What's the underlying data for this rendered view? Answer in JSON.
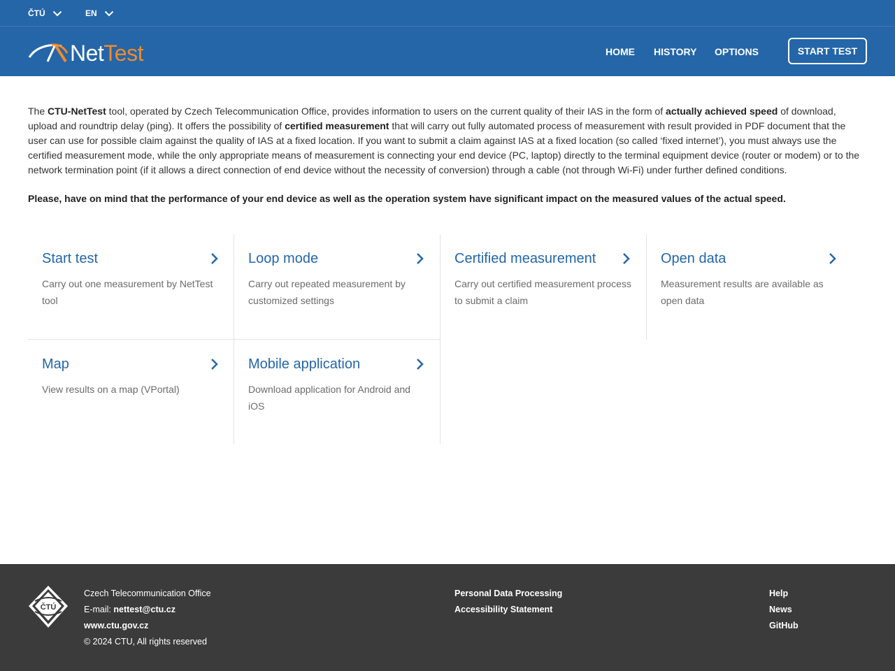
{
  "topbar": {
    "org_selector": "ČTÚ",
    "lang_selector": "EN"
  },
  "header": {
    "logo_net": "Net",
    "logo_test": "Test",
    "nav": {
      "home": "HOME",
      "history": "HISTORY",
      "options": "OPTIONS"
    },
    "start_button": "START TEST"
  },
  "intro": {
    "p1_a": "The ",
    "p1_b": "CTU-NetTest",
    "p1_c": " tool, operated by Czech Telecommunication Office, provides information to users on the current quality of their IAS in the form of ",
    "p1_d": "actually achieved speed",
    "p1_e": " of download, upload and roundtrip delay (ping). It offers the possibility of ",
    "p1_f": "certified measurement",
    "p1_g": " that will carry out fully automated process of measurement with result provided in PDF document that the user can use for possible claim against the quality of IAS at a fixed location. If you want to submit a claim against IAS at a fixed location (so called ‘fixed internet’), you must always use the certified measurement mode, while the only appropriate means of measurement is connecting your end device (PC, laptop) directly to the terminal equipment device (router or modem) or to the network termination point (if it allows a direct connection of end device without the necessity of conversion) through a cable (not through Wi-Fi) under further defined conditions.",
    "warning": "Please, have on mind that the performance of your end device as well as the operation system have significant impact on the measured values of the actual speed."
  },
  "cards": [
    {
      "title": "Start test",
      "desc": "Carry out one measurement by NetTest tool"
    },
    {
      "title": "Loop mode",
      "desc": "Carry out repeated measurement by customized settings"
    },
    {
      "title": "Certified measurement",
      "desc": "Carry out certified measurement process to submit a claim"
    },
    {
      "title": "Open data",
      "desc": "Measurement results are available as open data"
    },
    {
      "title": "Map",
      "desc": "View results on a map (VPortal)"
    },
    {
      "title": "Mobile application",
      "desc": "Download application for Android and iOS"
    }
  ],
  "footer": {
    "emblem_text": "ČTÚ",
    "org_name": "Czech Telecommunication Office",
    "email_label": "E-mail: ",
    "email": "nettest@ctu.cz",
    "website": "www.ctu.gov.cz",
    "copyright": "© 2024 CTU, All rights reserved",
    "links_mid": [
      "Personal Data Processing",
      "Accessibility Statement"
    ],
    "links_right": [
      "Help",
      "News",
      "GitHub"
    ]
  },
  "colors": {
    "brand_blue": "#2466a8",
    "logo_orange": "#f08a2a",
    "footer_bg": "#3b3b3b"
  }
}
